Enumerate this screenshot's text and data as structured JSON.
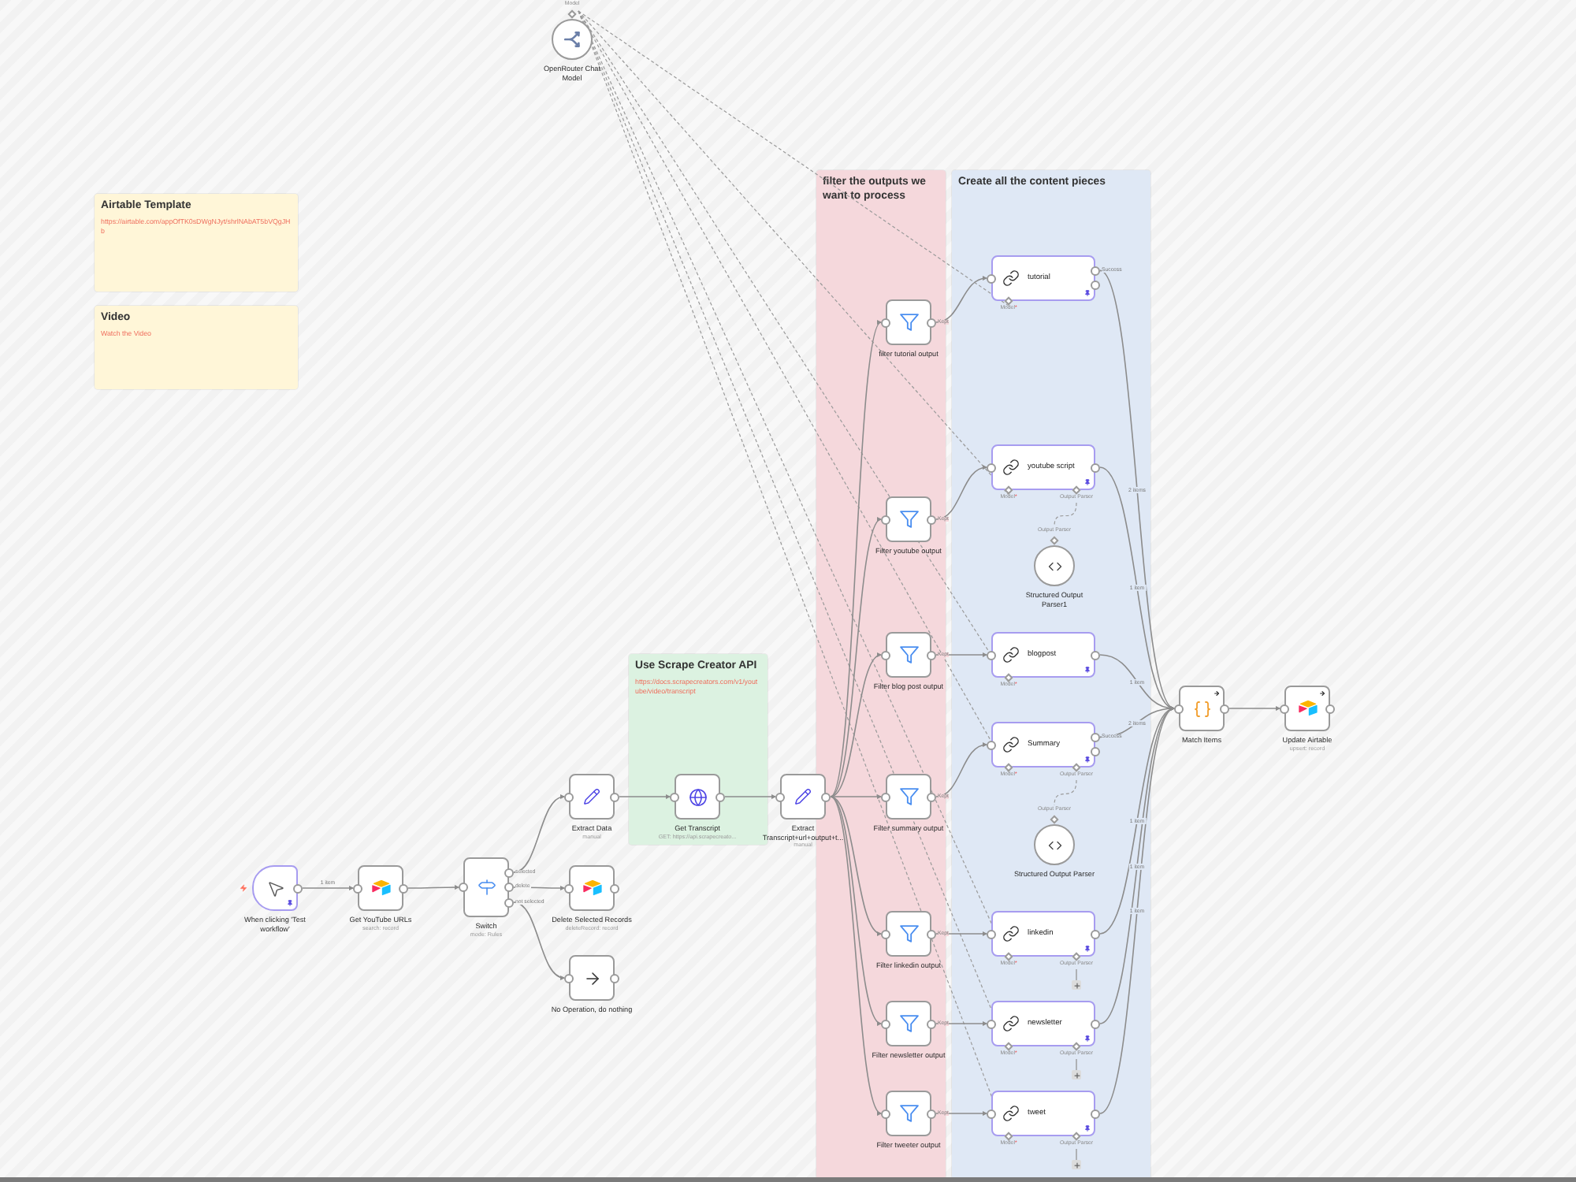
{
  "sticky_notes": [
    {
      "title": "Airtable Template",
      "link": "https://airtable.com/appOfTK0sDWgNJyt/shrlNAbAT5bVQgJHb",
      "color": "#fff6d8"
    },
    {
      "title": "Video",
      "link": "Watch the Video",
      "color": "#fff6d8"
    },
    {
      "title": "Use Scrape Creator API",
      "link": "https://docs.scrapecreators.com/v1/youtube/video/transcript",
      "color": "#dcf2e1"
    },
    {
      "title": "filter the outputs we want to process",
      "color": "#f5d8dc"
    },
    {
      "title": "Create all the content pieces",
      "color": "#dfe8f5"
    }
  ],
  "nodes": [
    {
      "kind": "model",
      "label": "OpenRouter Chat Model",
      "port_label": "Model",
      "pinned": false,
      "execute_once": false
    },
    {
      "kind": "trigger",
      "label": "When clicking 'Test workflow'",
      "edge_label": "1 item",
      "pinned": true,
      "execute_once": false
    },
    {
      "kind": "airtable",
      "label": "Get YouTube URLs",
      "subtitle": "search: record",
      "pinned": false,
      "execute_once": false
    },
    {
      "kind": "switch",
      "label": "Switch",
      "subtitle": "mode: Rules",
      "outputs": [
        "selected",
        "delete",
        "not selected"
      ],
      "pinned": false,
      "execute_once": false
    },
    {
      "kind": "edit",
      "label": "Extract Data",
      "subtitle": "manual",
      "pinned": false,
      "execute_once": false
    },
    {
      "kind": "airtable",
      "label": "Delete Selected Records",
      "subtitle": "deleteRecord: record",
      "pinned": false,
      "execute_once": false
    },
    {
      "kind": "noop",
      "label": "No Operation, do nothing",
      "pinned": false,
      "execute_once": false
    },
    {
      "kind": "http",
      "label": "Get Transcript",
      "subtitle": "GET: https://api.scrapecreato...",
      "pinned": false,
      "execute_once": false
    },
    {
      "kind": "edit",
      "label": "Extract Transcript+url+output+t...",
      "subtitle": "manual",
      "pinned": false,
      "execute_once": false
    },
    {
      "kind": "filter",
      "label": "filter tutorial output",
      "outputs": [
        "Kept"
      ],
      "pinned": false,
      "execute_once": false
    },
    {
      "kind": "filter",
      "label": "Filter youtube output",
      "outputs": [
        "Kept"
      ],
      "pinned": false,
      "execute_once": false
    },
    {
      "kind": "filter",
      "label": "Filter blog post output",
      "outputs": [
        "Kept"
      ],
      "pinned": false,
      "execute_once": false
    },
    {
      "kind": "filter",
      "label": "Filter summary output",
      "outputs": [
        "Kept"
      ],
      "pinned": false,
      "execute_once": false
    },
    {
      "kind": "filter",
      "label": "Filter linkedin output",
      "outputs": [
        "Kept"
      ],
      "pinned": false,
      "execute_once": false
    },
    {
      "kind": "filter",
      "label": "Filter newsletter output",
      "outputs": [
        "Kept"
      ],
      "pinned": false,
      "execute_once": false
    },
    {
      "kind": "filter",
      "label": "Filter tweeter output",
      "outputs": [
        "Kept"
      ],
      "pinned": false,
      "execute_once": false
    },
    {
      "kind": "chain",
      "label": "tutorial",
      "outputs": [
        "Success"
      ],
      "error_output": true,
      "edge_label": "2 items",
      "sub_ports": [
        {
          "label": "Model",
          "mark": "*"
        }
      ],
      "pinned": true,
      "execute_once": false
    },
    {
      "kind": "chain",
      "label": "youtube script",
      "error_output": false,
      "edge_label": "1 item",
      "sub_ports": [
        {
          "label": "Model",
          "mark": "*"
        },
        {
          "label": "Output Parser",
          "connected": true
        }
      ],
      "pinned": true,
      "execute_once": false
    },
    {
      "kind": "parser",
      "label": "Structured Output Parser1",
      "port_label": "Output Parser",
      "pinned": false,
      "execute_once": false
    },
    {
      "kind": "chain",
      "label": "blogpost",
      "error_output": false,
      "edge_label": "1 item",
      "sub_ports": [
        {
          "label": "Model",
          "mark": "*"
        }
      ],
      "pinned": true,
      "execute_once": false
    },
    {
      "kind": "chain",
      "label": "Summary",
      "outputs": [
        "Success"
      ],
      "error_output": true,
      "edge_label": "2 items",
      "sub_ports": [
        {
          "label": "Model",
          "mark": "*"
        },
        {
          "label": "Output Parser",
          "connected": true
        }
      ],
      "pinned": true,
      "execute_once": false
    },
    {
      "kind": "parser",
      "label": "Structured Output Parser",
      "port_label": "Output Parser",
      "pinned": false,
      "execute_once": false
    },
    {
      "kind": "chain",
      "label": "linkedin",
      "error_output": false,
      "edge_label": "1 item",
      "sub_ports": [
        {
          "label": "Model",
          "mark": "*"
        },
        {
          "label": "Output Parser",
          "connected": false
        }
      ],
      "pinned": true,
      "execute_once": false
    },
    {
      "kind": "chain",
      "label": "newsletter",
      "error_output": false,
      "edge_label": "1 item",
      "sub_ports": [
        {
          "label": "Model",
          "mark": "*"
        },
        {
          "label": "Output Parser",
          "connected": false
        }
      ],
      "pinned": true,
      "execute_once": false
    },
    {
      "kind": "chain",
      "label": "tweet",
      "error_output": false,
      "edge_label": "1 item",
      "sub_ports": [
        {
          "label": "Model",
          "mark": "*"
        },
        {
          "label": "Output Parser",
          "connected": false
        }
      ],
      "pinned": true,
      "execute_once": false
    },
    {
      "kind": "code",
      "label": "Match Items",
      "pinned": false,
      "execute_once": true
    },
    {
      "kind": "airtable",
      "label": "Update Airtable",
      "subtitle": "upsert: record",
      "pinned": false,
      "execute_once": true
    }
  ]
}
